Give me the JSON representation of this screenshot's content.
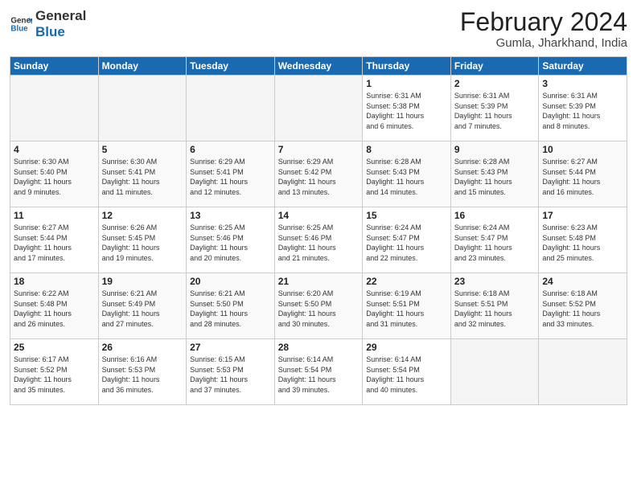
{
  "logo": {
    "line1": "General",
    "line2": "Blue"
  },
  "title": "February 2024",
  "location": "Gumla, Jharkhand, India",
  "days_of_week": [
    "Sunday",
    "Monday",
    "Tuesday",
    "Wednesday",
    "Thursday",
    "Friday",
    "Saturday"
  ],
  "weeks": [
    [
      {
        "day": "",
        "info": ""
      },
      {
        "day": "",
        "info": ""
      },
      {
        "day": "",
        "info": ""
      },
      {
        "day": "",
        "info": ""
      },
      {
        "day": "1",
        "info": "Sunrise: 6:31 AM\nSunset: 5:38 PM\nDaylight: 11 hours\nand 6 minutes."
      },
      {
        "day": "2",
        "info": "Sunrise: 6:31 AM\nSunset: 5:39 PM\nDaylight: 11 hours\nand 7 minutes."
      },
      {
        "day": "3",
        "info": "Sunrise: 6:31 AM\nSunset: 5:39 PM\nDaylight: 11 hours\nand 8 minutes."
      }
    ],
    [
      {
        "day": "4",
        "info": "Sunrise: 6:30 AM\nSunset: 5:40 PM\nDaylight: 11 hours\nand 9 minutes."
      },
      {
        "day": "5",
        "info": "Sunrise: 6:30 AM\nSunset: 5:41 PM\nDaylight: 11 hours\nand 11 minutes."
      },
      {
        "day": "6",
        "info": "Sunrise: 6:29 AM\nSunset: 5:41 PM\nDaylight: 11 hours\nand 12 minutes."
      },
      {
        "day": "7",
        "info": "Sunrise: 6:29 AM\nSunset: 5:42 PM\nDaylight: 11 hours\nand 13 minutes."
      },
      {
        "day": "8",
        "info": "Sunrise: 6:28 AM\nSunset: 5:43 PM\nDaylight: 11 hours\nand 14 minutes."
      },
      {
        "day": "9",
        "info": "Sunrise: 6:28 AM\nSunset: 5:43 PM\nDaylight: 11 hours\nand 15 minutes."
      },
      {
        "day": "10",
        "info": "Sunrise: 6:27 AM\nSunset: 5:44 PM\nDaylight: 11 hours\nand 16 minutes."
      }
    ],
    [
      {
        "day": "11",
        "info": "Sunrise: 6:27 AM\nSunset: 5:44 PM\nDaylight: 11 hours\nand 17 minutes."
      },
      {
        "day": "12",
        "info": "Sunrise: 6:26 AM\nSunset: 5:45 PM\nDaylight: 11 hours\nand 19 minutes."
      },
      {
        "day": "13",
        "info": "Sunrise: 6:25 AM\nSunset: 5:46 PM\nDaylight: 11 hours\nand 20 minutes."
      },
      {
        "day": "14",
        "info": "Sunrise: 6:25 AM\nSunset: 5:46 PM\nDaylight: 11 hours\nand 21 minutes."
      },
      {
        "day": "15",
        "info": "Sunrise: 6:24 AM\nSunset: 5:47 PM\nDaylight: 11 hours\nand 22 minutes."
      },
      {
        "day": "16",
        "info": "Sunrise: 6:24 AM\nSunset: 5:47 PM\nDaylight: 11 hours\nand 23 minutes."
      },
      {
        "day": "17",
        "info": "Sunrise: 6:23 AM\nSunset: 5:48 PM\nDaylight: 11 hours\nand 25 minutes."
      }
    ],
    [
      {
        "day": "18",
        "info": "Sunrise: 6:22 AM\nSunset: 5:48 PM\nDaylight: 11 hours\nand 26 minutes."
      },
      {
        "day": "19",
        "info": "Sunrise: 6:21 AM\nSunset: 5:49 PM\nDaylight: 11 hours\nand 27 minutes."
      },
      {
        "day": "20",
        "info": "Sunrise: 6:21 AM\nSunset: 5:50 PM\nDaylight: 11 hours\nand 28 minutes."
      },
      {
        "day": "21",
        "info": "Sunrise: 6:20 AM\nSunset: 5:50 PM\nDaylight: 11 hours\nand 30 minutes."
      },
      {
        "day": "22",
        "info": "Sunrise: 6:19 AM\nSunset: 5:51 PM\nDaylight: 11 hours\nand 31 minutes."
      },
      {
        "day": "23",
        "info": "Sunrise: 6:18 AM\nSunset: 5:51 PM\nDaylight: 11 hours\nand 32 minutes."
      },
      {
        "day": "24",
        "info": "Sunrise: 6:18 AM\nSunset: 5:52 PM\nDaylight: 11 hours\nand 33 minutes."
      }
    ],
    [
      {
        "day": "25",
        "info": "Sunrise: 6:17 AM\nSunset: 5:52 PM\nDaylight: 11 hours\nand 35 minutes."
      },
      {
        "day": "26",
        "info": "Sunrise: 6:16 AM\nSunset: 5:53 PM\nDaylight: 11 hours\nand 36 minutes."
      },
      {
        "day": "27",
        "info": "Sunrise: 6:15 AM\nSunset: 5:53 PM\nDaylight: 11 hours\nand 37 minutes."
      },
      {
        "day": "28",
        "info": "Sunrise: 6:14 AM\nSunset: 5:54 PM\nDaylight: 11 hours\nand 39 minutes."
      },
      {
        "day": "29",
        "info": "Sunrise: 6:14 AM\nSunset: 5:54 PM\nDaylight: 11 hours\nand 40 minutes."
      },
      {
        "day": "",
        "info": ""
      },
      {
        "day": "",
        "info": ""
      }
    ]
  ],
  "accent_color": "#1a6ab1"
}
